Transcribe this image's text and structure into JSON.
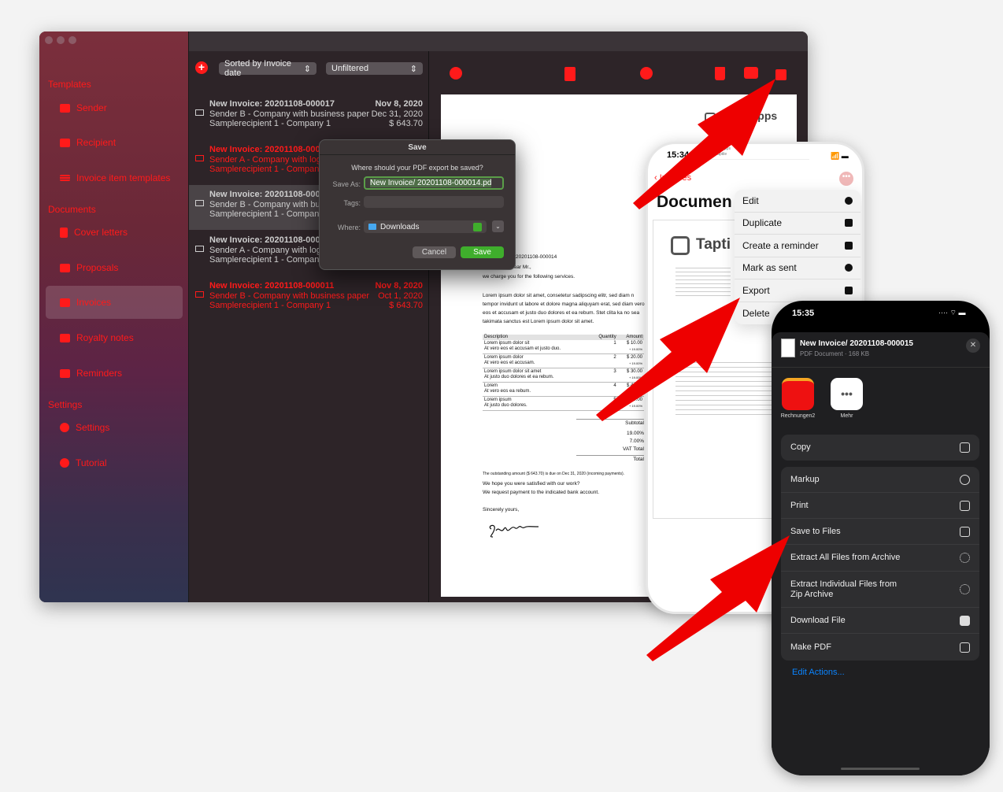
{
  "colors": {
    "accent": "#ff1a1a",
    "arrow": "#ee0000",
    "save_green": "#3fae2c",
    "ios_blue": "#0a84ff"
  },
  "mac": {
    "sidebar": {
      "sections": [
        {
          "title": "Templates",
          "items": [
            {
              "label": "Sender",
              "icon": "id-card-icon"
            },
            {
              "label": "Recipient",
              "icon": "person-card-icon"
            },
            {
              "label": "Invoice item templates",
              "icon": "list-icon"
            }
          ]
        },
        {
          "title": "Documents",
          "items": [
            {
              "label": "Cover letters",
              "icon": "document-icon"
            },
            {
              "label": "Proposals",
              "icon": "open-envelope-icon"
            },
            {
              "label": "Invoices",
              "icon": "envelope-icon",
              "selected": true
            },
            {
              "label": "Royalty notes",
              "icon": "envelope-icon"
            },
            {
              "label": "Reminders",
              "icon": "envelope-badge-icon"
            }
          ]
        },
        {
          "title": "Settings",
          "items": [
            {
              "label": "Settings",
              "icon": "gear-icon"
            },
            {
              "label": "Tutorial",
              "icon": "question-icon"
            }
          ]
        }
      ]
    },
    "list": {
      "sort": "Sorted by Invoice date",
      "filter": "Unfiltered",
      "rows": [
        {
          "title": "New Invoice: 20201108-000017",
          "sender": "Sender B - Company with business paper",
          "recipient": "Samplerecipient 1 - Company 1",
          "date": "Nov 8, 2020",
          "due": "Dec 31, 2020",
          "amount": "$ 643.70",
          "state": "normal"
        },
        {
          "title": "New Invoice: 20201108-000",
          "sender": "Sender A - Company with logo",
          "recipient": "Samplerecipient 1 - Company",
          "date": "",
          "due": "",
          "amount": "",
          "state": "overdue"
        },
        {
          "title": "New Invoice: 20201108-000",
          "sender": "Sender B - Company with busi",
          "recipient": "Samplerecipient 1 - Company 1",
          "date": "",
          "due": "",
          "amount": "",
          "state": "selected"
        },
        {
          "title": "New Invoice: 20201108-000",
          "sender": "Sender A - Company with logo",
          "recipient": "Samplerecipient 1 - Company 1",
          "date": "",
          "due": "",
          "amount": "",
          "state": "normal"
        },
        {
          "title": "New Invoice: 20201108-000011",
          "sender": "Sender B - Company with business paper",
          "recipient": "Samplerecipient 1 - Company 1",
          "date": "Nov 8, 2020",
          "due": "Oct 1, 2020",
          "amount": "$ 643.70",
          "state": "overdue"
        }
      ]
    },
    "toolbar": [
      "edit-icon",
      "duplicate-icon",
      "send-icon",
      "trash-icon",
      "print-icon",
      "share-icon"
    ],
    "pdf": {
      "brand": "e Apps",
      "invoice_no": "20201108-000014",
      "greeting": "Dear Mr.,",
      "intro": "we charge you for the following services.",
      "body": "Lorem ipsum dolor sit amet, consetetur sadipscing elitr, sed diam n tempor invidunt ut labore et dolore magna aliquyam erat, sed diam vero eos et accusam et justo duo dolores et ea rebum. Stet clita ka no sea takimata sanctus est Lorem ipsum dolor sit amet.",
      "columns": [
        "Description",
        "Quantity",
        "Amount"
      ],
      "items": [
        {
          "d1": "Lorem ipsum dolor sit",
          "d2": "At vero eos et accusam et justo duo.",
          "q": "1",
          "a": "$ 10.00",
          "v": "+ 19.00%"
        },
        {
          "d1": "Lorem ipsum dolor",
          "d2": "At vero eos et accusam.",
          "q": "2",
          "a": "$ 20.00",
          "v": "+ 19.00%"
        },
        {
          "d1": "Lorem ipsum dolor sit amet",
          "d2": "At justo duo dolores et ea rebum.",
          "q": "3",
          "a": "$ 30.00",
          "v": "+ 19.00%"
        },
        {
          "d1": "Lorem",
          "d2": "At vero eos ea rebum.",
          "q": "4",
          "a": "$ 40.00",
          "v": "+ 19.00%"
        },
        {
          "d1": "Lorem ipsum",
          "d2": "At justo duo dolores.",
          "q": "5",
          "a": "$ 50.00",
          "v": "+ 19.00%"
        }
      ],
      "subtotal": "Subtotal",
      "vat1": "19.00%",
      "vat2": "7.00%",
      "vat_total": "VAT Total",
      "total": "Total",
      "due_note": "The outstanding amount ($ 643.70) is due on Dec 31, 2020 (incoming payments).",
      "closing1": "We hope you were satisfied with our work?",
      "closing2": "We request payment to the indicated bank account.",
      "regards": "Sincerely yours,",
      "signature": "Signature"
    },
    "dialog": {
      "title": "Save",
      "question": "Where should your PDF export be saved?",
      "save_as_label": "Save As:",
      "save_as_value": "New Invoice/ 20201108-000014.pd",
      "tags_label": "Tags:",
      "where_label": "Where:",
      "where_value": "Downloads",
      "cancel": "Cancel",
      "save": "Save"
    }
  },
  "phone1": {
    "time": "15:34",
    "back": "Invoices",
    "title": "Documen",
    "doc_brand": "Tapti",
    "doc_header1": "Taptile Apps",
    "doc_header2": "Hr. Taptile",
    "menu": [
      {
        "label": "Edit",
        "icon": "pencil-icon"
      },
      {
        "label": "Duplicate",
        "icon": "duplicate-icon"
      },
      {
        "label": "Create a reminder",
        "icon": "envelope-badge-icon"
      },
      {
        "label": "Mark as sent",
        "icon": "send-icon"
      },
      {
        "label": "Export",
        "icon": "share-icon"
      },
      {
        "label": "Delete",
        "icon": "trash-icon"
      }
    ]
  },
  "phone2": {
    "time": "15:35",
    "file_name": "New Invoice/ 20201108-000015",
    "file_meta": "PDF Document · 168 KB",
    "apps": [
      {
        "label": "Rechnungen2"
      },
      {
        "label": "Mehr"
      }
    ],
    "copy": {
      "label": "Copy",
      "icon": "copy-icon"
    },
    "actions": [
      {
        "label": "Markup",
        "icon": "markup-icon"
      },
      {
        "label": "Print",
        "icon": "print-icon"
      },
      {
        "label": "Save to Files",
        "icon": "folder-icon"
      },
      {
        "label": "Extract All Files from Archive",
        "icon": "spinner-icon"
      },
      {
        "label": "Extract Individual Files from Zip Archive",
        "icon": "spinner-icon"
      },
      {
        "label": "Download File",
        "icon": "drive-icon"
      },
      {
        "label": "Make PDF",
        "icon": "document-icon"
      }
    ],
    "edit_actions": "Edit Actions..."
  }
}
